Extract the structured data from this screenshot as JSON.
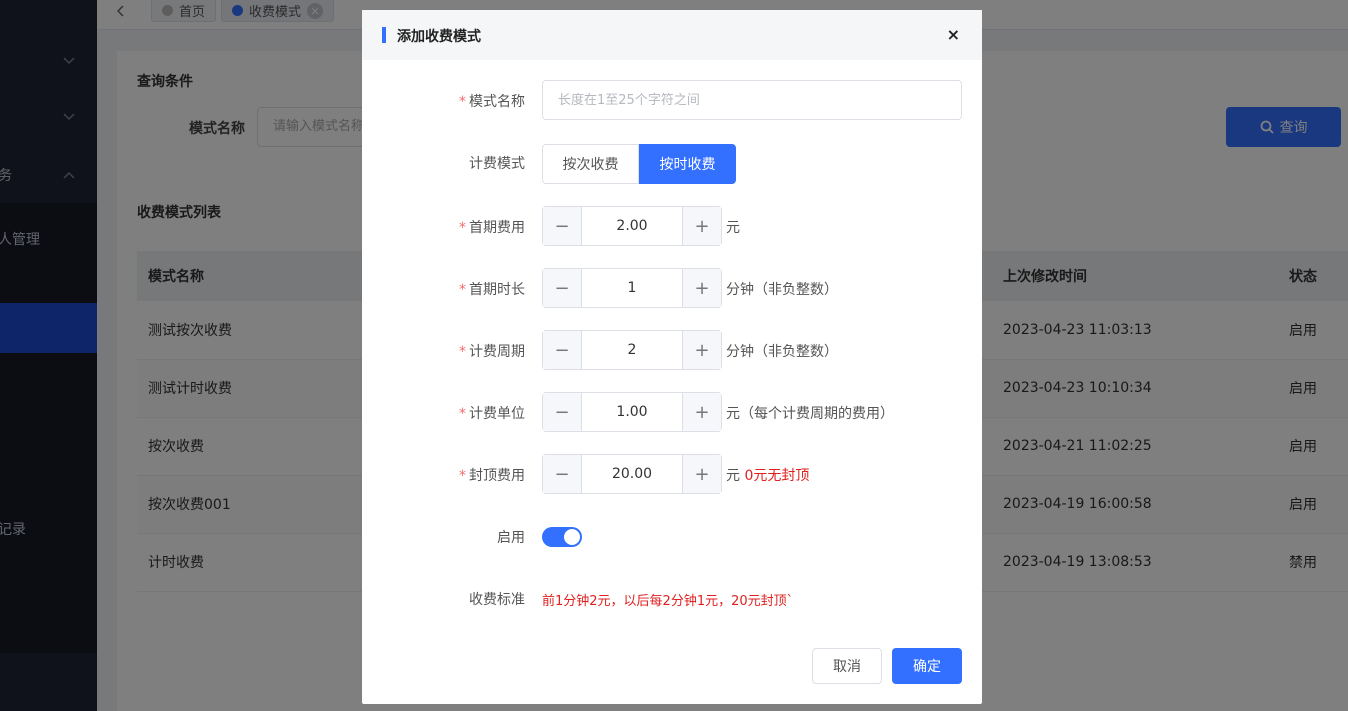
{
  "sidebar": {
    "items": [
      {
        "label": ""
      },
      {
        "label": ""
      },
      {
        "label": "务"
      },
      {
        "label": "人管理"
      },
      {
        "label": ""
      },
      {
        "label": "记录"
      }
    ]
  },
  "tabs": [
    {
      "label": "首页",
      "dot_color": "#bbbbbb"
    },
    {
      "label": "收费模式",
      "dot_color": "#3370ff"
    }
  ],
  "query": {
    "section_title": "查询条件",
    "name_label": "模式名称",
    "name_placeholder": "请输入模式名称",
    "search_button": "查询"
  },
  "list": {
    "section_title": "收费模式列表",
    "columns": [
      "模式名称",
      "上次修改时间",
      "状态"
    ],
    "rows": [
      {
        "name": "测试按次收费",
        "modified": "2023-04-23 11:03:13",
        "status": "启用"
      },
      {
        "name": "测试计时收费",
        "modified": "2023-04-23 10:10:34",
        "status": "启用"
      },
      {
        "name": "按次收费",
        "modified": "2023-04-21 11:02:25",
        "status": "启用"
      },
      {
        "name": "按次收费001",
        "modified": "2023-04-19 16:00:58",
        "status": "启用"
      },
      {
        "name": "计时收费",
        "modified": "2023-04-19 13:08:53",
        "status": "禁用"
      }
    ]
  },
  "dialog": {
    "title": "添加收费模式",
    "close": "×",
    "fields": {
      "name": {
        "label": "模式名称",
        "placeholder": "长度在1至25个字符之间",
        "value": ""
      },
      "billing_mode": {
        "label": "计费模式",
        "options": [
          "按次收费",
          "按时收费"
        ],
        "selected": "按时收费"
      },
      "first_fee": {
        "label": "首期费用",
        "value": "2.00",
        "unit": "元"
      },
      "first_duration": {
        "label": "首期时长",
        "value": "1",
        "unit": "分钟（非负整数）"
      },
      "period": {
        "label": "计费周期",
        "value": "2",
        "unit": "分钟（非负整数）"
      },
      "unit_fee": {
        "label": "计费单位",
        "value": "1.00",
        "unit": "元（每个计费周期的费用）"
      },
      "cap_fee": {
        "label": "封顶费用",
        "value": "20.00",
        "unit": "元",
        "note": "0元无封顶"
      },
      "enabled": {
        "label": "启用",
        "value": true
      },
      "standard": {
        "label": "收费标准",
        "text": "前1分钟2元，以后每2分钟1元，20元封顶`"
      }
    },
    "minus": "−",
    "plus": "+",
    "cancel": "取消",
    "confirm": "确定"
  },
  "colors": {
    "primary": "#3370ff",
    "danger": "#e02020",
    "sidebar_bg": "#1e2535",
    "sidebar_active": "#1f4ad3"
  }
}
